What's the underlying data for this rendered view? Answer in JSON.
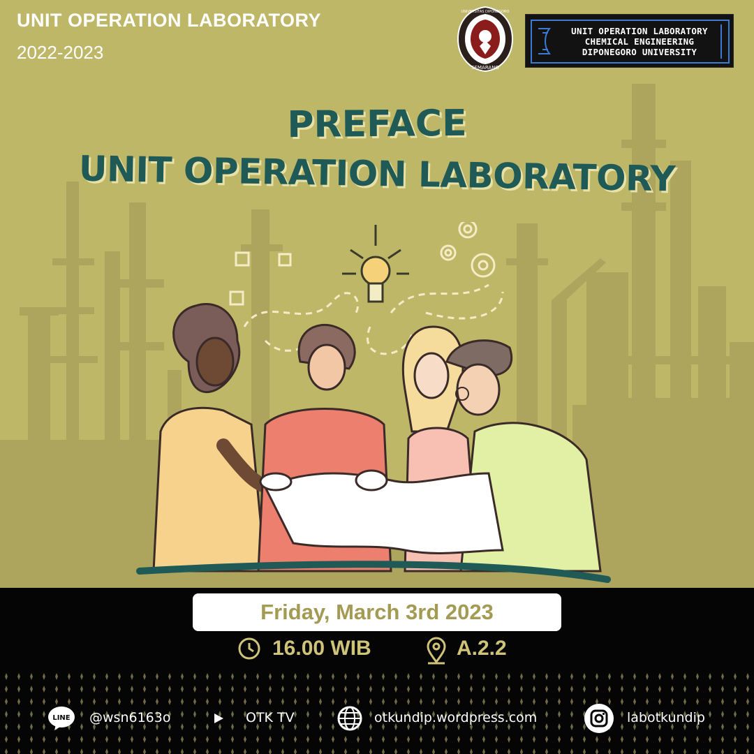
{
  "header": {
    "title": "UNIT OPERATION LABORATORY",
    "year": "2022-2023"
  },
  "badge": {
    "line1": "UNIT OPERATION LABORATORY",
    "line2": "CHEMICAL ENGINEERING",
    "line3": "DIPONEGORO UNIVERSITY"
  },
  "seal": {
    "arc_text": "UNIVERSITAS DIPONEGORO",
    "city": "SEMARANG"
  },
  "headline": {
    "line1": "PREFACE",
    "line2": "UNIT OPERATION LABORATORY"
  },
  "event": {
    "date": "Friday, March 3rd 2023",
    "time": "16.00 WIB",
    "location": "A.2.2"
  },
  "footer": {
    "line_label": "LINE",
    "line_id": "@wsn6163o",
    "youtube": "OTK TV",
    "website": "otkundip.wordpress.com",
    "instagram": "labotkundip"
  },
  "colors": {
    "background": "#bfb768",
    "headline": "#1f5a57",
    "accent_gold": "#cfc37a",
    "bottom_band": "#050505"
  }
}
